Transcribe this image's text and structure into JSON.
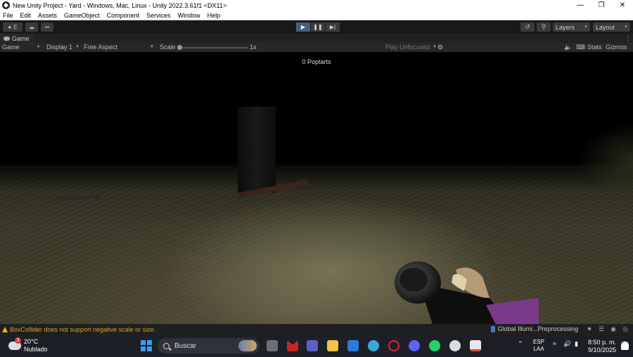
{
  "window": {
    "title": "New Unity Project - Yard - Windows, Mac, Linux - Unity 2022.3.61f1 <DX11>",
    "controls": [
      "minimize-icon",
      "restore-icon",
      "close-icon"
    ]
  },
  "menu": [
    "File",
    "Edit",
    "Assets",
    "GameObject",
    "Component",
    "Services",
    "Window",
    "Help"
  ],
  "toolbar": {
    "account_initial": "E",
    "layers_label": "Layers",
    "layout_label": "Layout"
  },
  "game_tab": {
    "label": "Game",
    "mode_label": "Game",
    "display_label": "Display 1",
    "aspect_label": "Free Aspect",
    "scale_label": "Scale",
    "scale_value": "1x",
    "scale_fraction": 0.0,
    "play_focus_label": "Play Unfocused",
    "stats_label": "Stats",
    "gizmos_label": "Gizmos"
  },
  "viewport": {
    "hud_counter": "0 Poptarts"
  },
  "status": {
    "warning": "BoxCollider does not support negative scale or size.",
    "progress_label": "Global Illumi...Preprocessing"
  },
  "taskbar": {
    "weather_temp": "20°C",
    "weather_desc": "Nublado",
    "weather_badge": "3",
    "search_placeholder": "Buscar",
    "lang_top": "ESP",
    "lang_bottom": "LAA",
    "time": "8:50 p. m.",
    "date": "9/10/2025"
  }
}
